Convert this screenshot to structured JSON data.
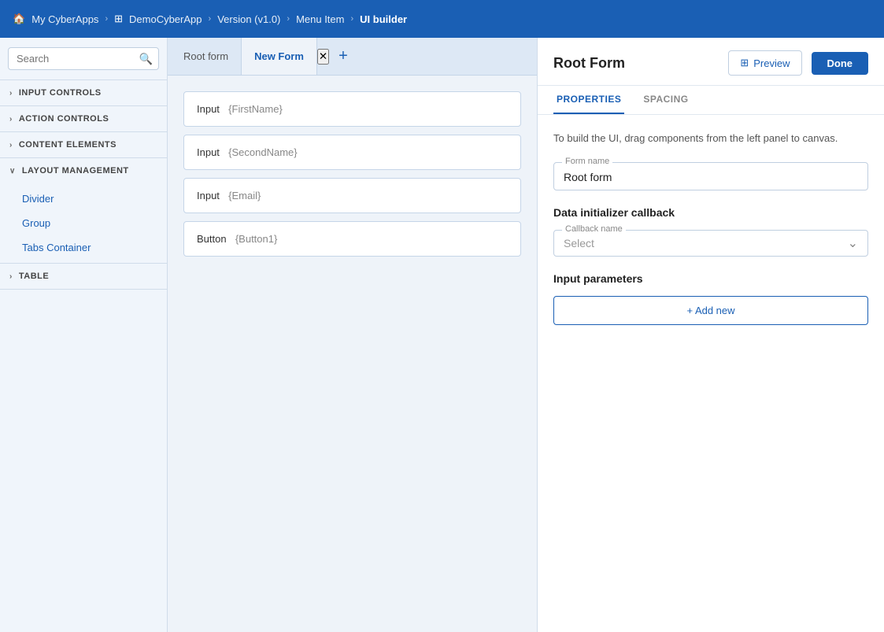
{
  "nav": {
    "items": [
      {
        "label": "My CyberApps",
        "icon": "🏠"
      },
      {
        "label": "DemoCyberApp",
        "icon": "⊞"
      },
      {
        "label": "Version (v1.0)",
        "icon": null
      },
      {
        "label": "Menu Item",
        "icon": null
      },
      {
        "label": "UI builder",
        "icon": null
      }
    ]
  },
  "sidebar": {
    "search_placeholder": "Search",
    "sections": [
      {
        "id": "input-controls",
        "label": "Input Controls",
        "expanded": false,
        "items": []
      },
      {
        "id": "action-controls",
        "label": "Action Controls",
        "expanded": false,
        "items": []
      },
      {
        "id": "content-elements",
        "label": "Content Elements",
        "expanded": false,
        "items": []
      },
      {
        "id": "layout-management",
        "label": "Layout Management",
        "expanded": true,
        "items": [
          "Divider",
          "Group",
          "Tabs Container"
        ]
      },
      {
        "id": "table",
        "label": "Table",
        "expanded": false,
        "items": []
      }
    ]
  },
  "tabs": [
    {
      "id": "root-form",
      "label": "Root form",
      "active": false,
      "closable": false
    },
    {
      "id": "new-form",
      "label": "New Form",
      "active": true,
      "closable": true
    }
  ],
  "add_tab_label": "+",
  "canvas": {
    "fields": [
      {
        "label": "Input",
        "value": "{FirstName}"
      },
      {
        "label": "Input",
        "value": "{SecondName}"
      },
      {
        "label": "Input",
        "value": "{Email}"
      },
      {
        "label": "Button",
        "value": "{Button1}"
      }
    ]
  },
  "right_panel": {
    "title": "Root Form",
    "preview_label": "Preview",
    "done_label": "Done",
    "tabs": [
      {
        "id": "properties",
        "label": "Properties",
        "active": true
      },
      {
        "id": "spacing",
        "label": "Spacing",
        "active": false
      }
    ],
    "hint": "To build the UI, drag components from the left panel to canvas.",
    "form_name_label": "Form name",
    "form_name_value": "Root form",
    "data_initializer_label": "Data initializer callback",
    "callback_name_label": "Callback name",
    "callback_placeholder": "Select",
    "input_parameters_label": "Input parameters",
    "add_new_label": "+ Add new"
  }
}
